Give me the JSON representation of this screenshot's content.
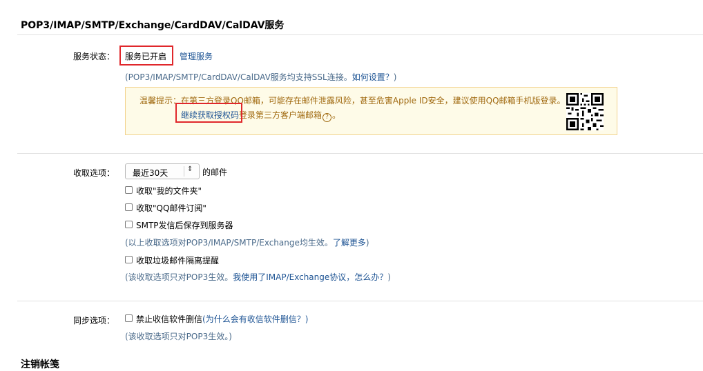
{
  "section": {
    "title": "POP3/IMAP/SMTP/Exchange/CardDAV/CalDAV服务"
  },
  "service": {
    "label": "服务状态：",
    "status": "服务已开启",
    "manage": "管理服务",
    "note_prefix": "(POP3/IMAP/SMTP/CardDAV/CalDAV服务均支持SSL连接。",
    "note_link": "如何设置？",
    "note_suffix": ")"
  },
  "warning": {
    "line1": "温馨提示：在第三方登录QQ邮箱，可能存在邮件泄露风险，甚至危害Apple ID安全，建议使用QQ邮箱手机版登录。",
    "link": "继续获取授权码",
    "line2_rest": "登录第三方客户端邮箱",
    "help_mark": "?",
    "end": "。"
  },
  "receive": {
    "label": "收取选项：",
    "select_value": "最近30天",
    "select_suffix": "的邮件",
    "options": [
      {
        "label": "收取\"我的文件夹\"",
        "checked": false
      },
      {
        "label": "收取\"QQ邮件订阅\"",
        "checked": false
      },
      {
        "label": "SMTP发信后保存到服务器",
        "checked": false
      }
    ],
    "note1_prefix": "(以上收取选项对POP3/IMAP/SMTP/Exchange均生效。",
    "note1_link": "了解更多",
    "note1_suffix": ")",
    "spam_option": {
      "label": "收取垃圾邮件隔离提醒",
      "checked": false
    },
    "note2_prefix": "(该收取选项只对POP3生效。",
    "note2_link": "我使用了IMAP/Exchange协议，怎么办？",
    "note2_suffix": ")"
  },
  "sync": {
    "label": "同步选项：",
    "option": "禁止收信软件删信",
    "option_link": "(为什么会有收信软件删信？)",
    "note": "(该收取选项只对POP3生效。)"
  },
  "next_section": {
    "title": "注销帐笺"
  },
  "colors": {
    "highlight": "#e0272b",
    "link": "#1e5494",
    "warn_bg": "#fefbe8"
  }
}
